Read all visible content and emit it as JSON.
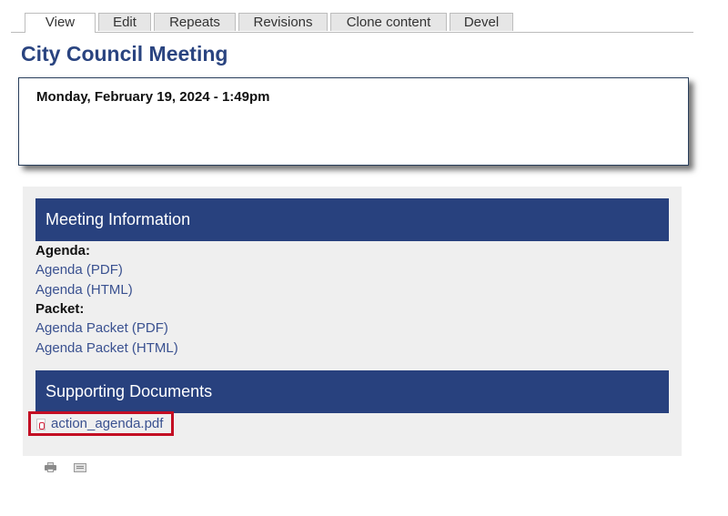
{
  "tabs": [
    {
      "label": "View",
      "active": true
    },
    {
      "label": "Edit"
    },
    {
      "label": "Repeats"
    },
    {
      "label": "Revisions"
    },
    {
      "label": "Clone content"
    },
    {
      "label": "Devel"
    }
  ],
  "page": {
    "title": "City Council Meeting",
    "date": "Monday, February 19, 2024 - 1:49pm"
  },
  "meeting_info": {
    "header": "Meeting Information",
    "agenda_label": "Agenda:",
    "agenda_links": [
      "Agenda (PDF)",
      "Agenda (HTML)"
    ],
    "packet_label": "Packet:",
    "packet_links": [
      "Agenda Packet (PDF)",
      "Agenda Packet (HTML)"
    ]
  },
  "supporting_documents": {
    "header": "Supporting Documents",
    "files": [
      {
        "name": "action_agenda.pdf",
        "icon": "pdf-file-icon",
        "highlight_color": "#c30d23"
      }
    ]
  },
  "footer_icons": [
    "print-icon",
    "email-icon"
  ],
  "colors": {
    "title": "#2a4480",
    "section_header_bg": "#28417e",
    "link": "#3a5190",
    "panel_bg": "#efefef"
  }
}
